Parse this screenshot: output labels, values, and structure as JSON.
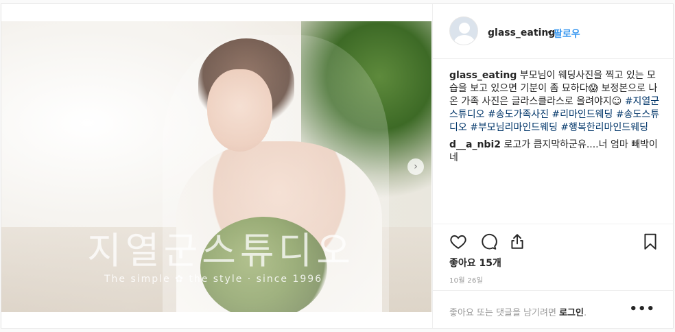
{
  "post": {
    "watermark_main": "지열군스튜디오",
    "watermark_sub": "The simple ✿ the style · since 1996"
  },
  "header": {
    "username": "glass_eating",
    "separator": "•",
    "follow_label": "팔로우"
  },
  "caption": {
    "username": "glass_eating",
    "text": " 부모님이 웨딩사진을 찍고 있는 모습을 보고 있으면 기분이 좀 묘하다😱 보정본으로 나온 가족 사진은 글라스클라스로 올려야지☺",
    "hashtags": "#지열군스튜디오 #송도가족사진 #리마인드웨딩 #송도스튜디오 #부모님리마인드웨딩 #행복한리마인드웨딩"
  },
  "comment": {
    "username": "d__a_nbi2",
    "text": " 로고가 큼지막하군유....너 엄마 빼박이네"
  },
  "actions": {
    "like_icon": "heart-icon",
    "comment_icon": "comment-icon",
    "share_icon": "share-icon",
    "save_icon": "bookmark-icon"
  },
  "likes_label": "좋아요 15개",
  "date_label": "10월 26일",
  "footer": {
    "prompt": "좋아요 또는 댓글을 남기려면 ",
    "login": "로그인",
    "period": ".",
    "more": "•••"
  },
  "colors": {
    "link_blue": "#3897f0",
    "hashtag": "#003569",
    "text": "#262626",
    "muted": "#999999"
  }
}
